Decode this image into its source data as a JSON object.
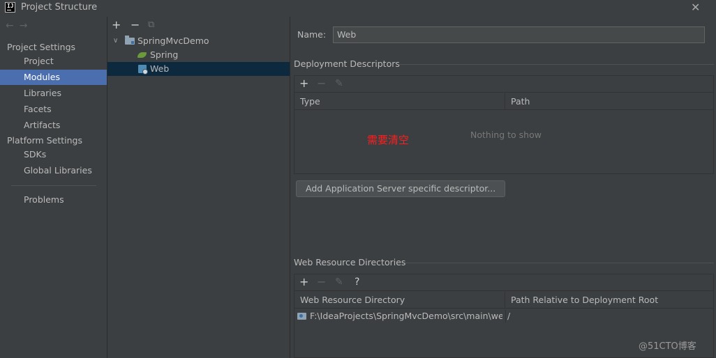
{
  "window": {
    "title": "Project Structure",
    "logo_text": "IJ",
    "close_glyph": "✕"
  },
  "nav": {
    "back_forward": "←→",
    "sections": [
      {
        "title": "Project Settings",
        "items": [
          "Project",
          "Modules",
          "Libraries",
          "Facets",
          "Artifacts"
        ]
      },
      {
        "title": "Platform Settings",
        "items": [
          "SDKs",
          "Global Libraries"
        ]
      }
    ],
    "extra_items": [
      "Problems"
    ],
    "selected": "Modules"
  },
  "tree": {
    "toolbar": {
      "add": "+",
      "remove": "−",
      "copy": "⧉"
    },
    "root": {
      "label": "SpringMvcDemo",
      "expanded_glyph": "∨",
      "icon": "module-folder-icon"
    },
    "children": [
      {
        "label": "Spring",
        "icon": "spring-leaf-icon"
      },
      {
        "label": "Web",
        "icon": "web-facet-icon",
        "selected": true
      }
    ]
  },
  "details": {
    "name_label": "Name:",
    "name_value": "Web",
    "deployment": {
      "title": "Deployment Descriptors",
      "toolbar": {
        "add": "+",
        "remove": "−",
        "edit": "✎"
      },
      "columns": [
        "Type",
        "Path"
      ],
      "empty_text": "Nothing to show",
      "annotation": "需要清空",
      "add_button": "Add Application Server specific descriptor..."
    },
    "web_resources": {
      "title": "Web Resource Directories",
      "toolbar": {
        "add": "+",
        "remove": "−",
        "edit": "✎",
        "help": "?"
      },
      "columns": [
        "Web Resource Directory",
        "Path Relative to Deployment Root"
      ],
      "rows": [
        {
          "directory": "F:\\IdeaProjects\\SpringMvcDemo\\src\\main\\we...",
          "relative_path": "/"
        }
      ]
    }
  },
  "watermark": "@51CTO博客",
  "colors": {
    "selection": "#4b6eaf",
    "tree_selection": "#0d293e",
    "annotation": "#ff1d1d"
  }
}
